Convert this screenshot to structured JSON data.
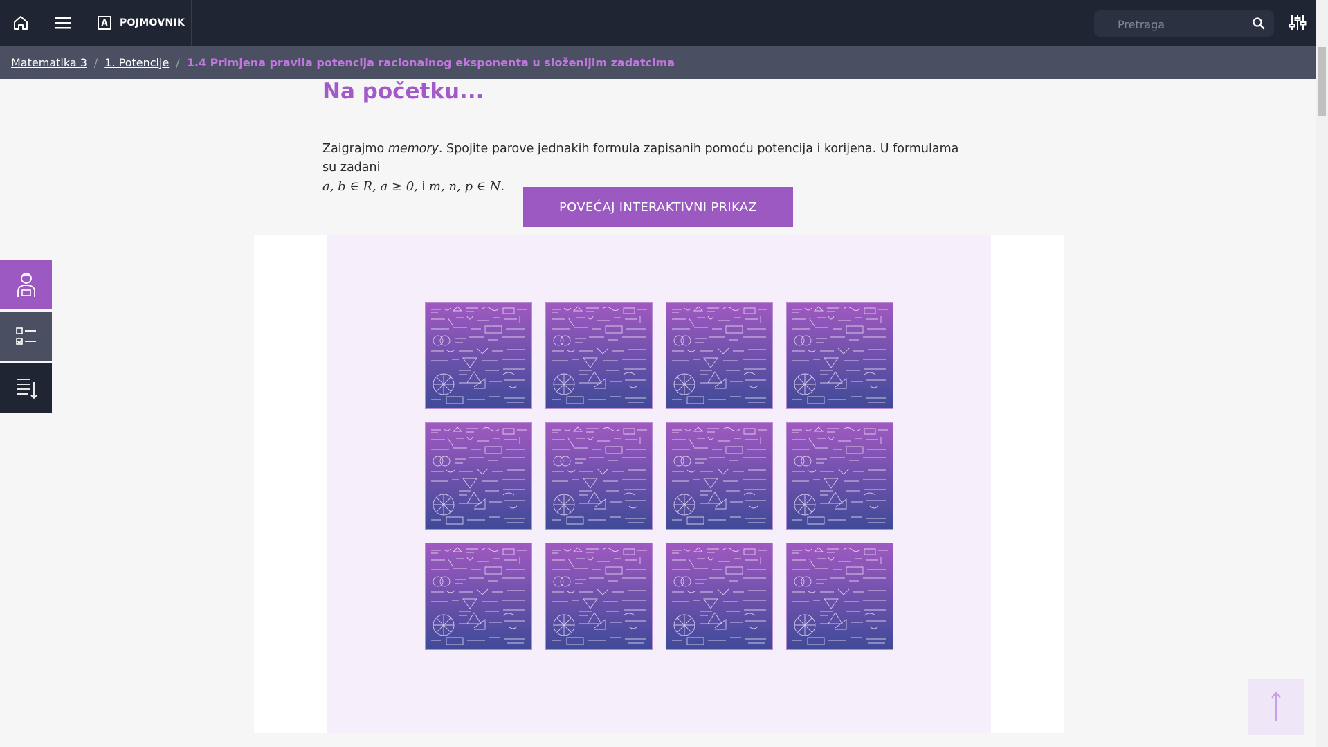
{
  "topbar": {
    "home_icon": "home-icon",
    "menu_icon": "hamburger-menu-icon",
    "glossary_icon_letter": "A",
    "glossary_label": "POJMOVNIK",
    "search_placeholder": "Pretraga",
    "search_icon": "search-icon",
    "settings_icon": "sliders-icon"
  },
  "breadcrumb": {
    "items": [
      "Matematika 3",
      "1. Potencije"
    ],
    "separator": "/",
    "current": "1.4 Primjena pravila potencija racionalnog eksponenta u složenijim zadatcima"
  },
  "content": {
    "title": "Na početku...",
    "intro_before": "Zaigrajmo ",
    "intro_italic": "memory",
    "intro_after": ". Spojite parove jednakih formula zapisanih pomoću potencija i korijena. U formulama su zadani",
    "math_1": "a,  b ∈ R, a ≥ 0,",
    "intro_and": " i ",
    "math_2": "m,  n,  p ∈ N",
    "intro_end": ".",
    "enlarge_button": "POVEĆAJ INTERAKTIVNI PRIKAZ"
  },
  "memory_game": {
    "rows": 3,
    "columns": 4,
    "cards_face_down": 12
  },
  "side_tabs": [
    "teacher-icon",
    "checklist-icon",
    "sort-list-icon"
  ],
  "back_to_top_icon": "arrow-up-icon",
  "colors": {
    "topbar": "#1f2533",
    "breadcrumb_bar": "#4a5061",
    "accent_purple": "#9b59c1",
    "title_purple": "#a35ac8",
    "current_crumb": "#c275e0",
    "game_background": "#f6eefa",
    "card_gradient_top": "#a059c0",
    "card_gradient_bottom": "#3f4a98"
  }
}
